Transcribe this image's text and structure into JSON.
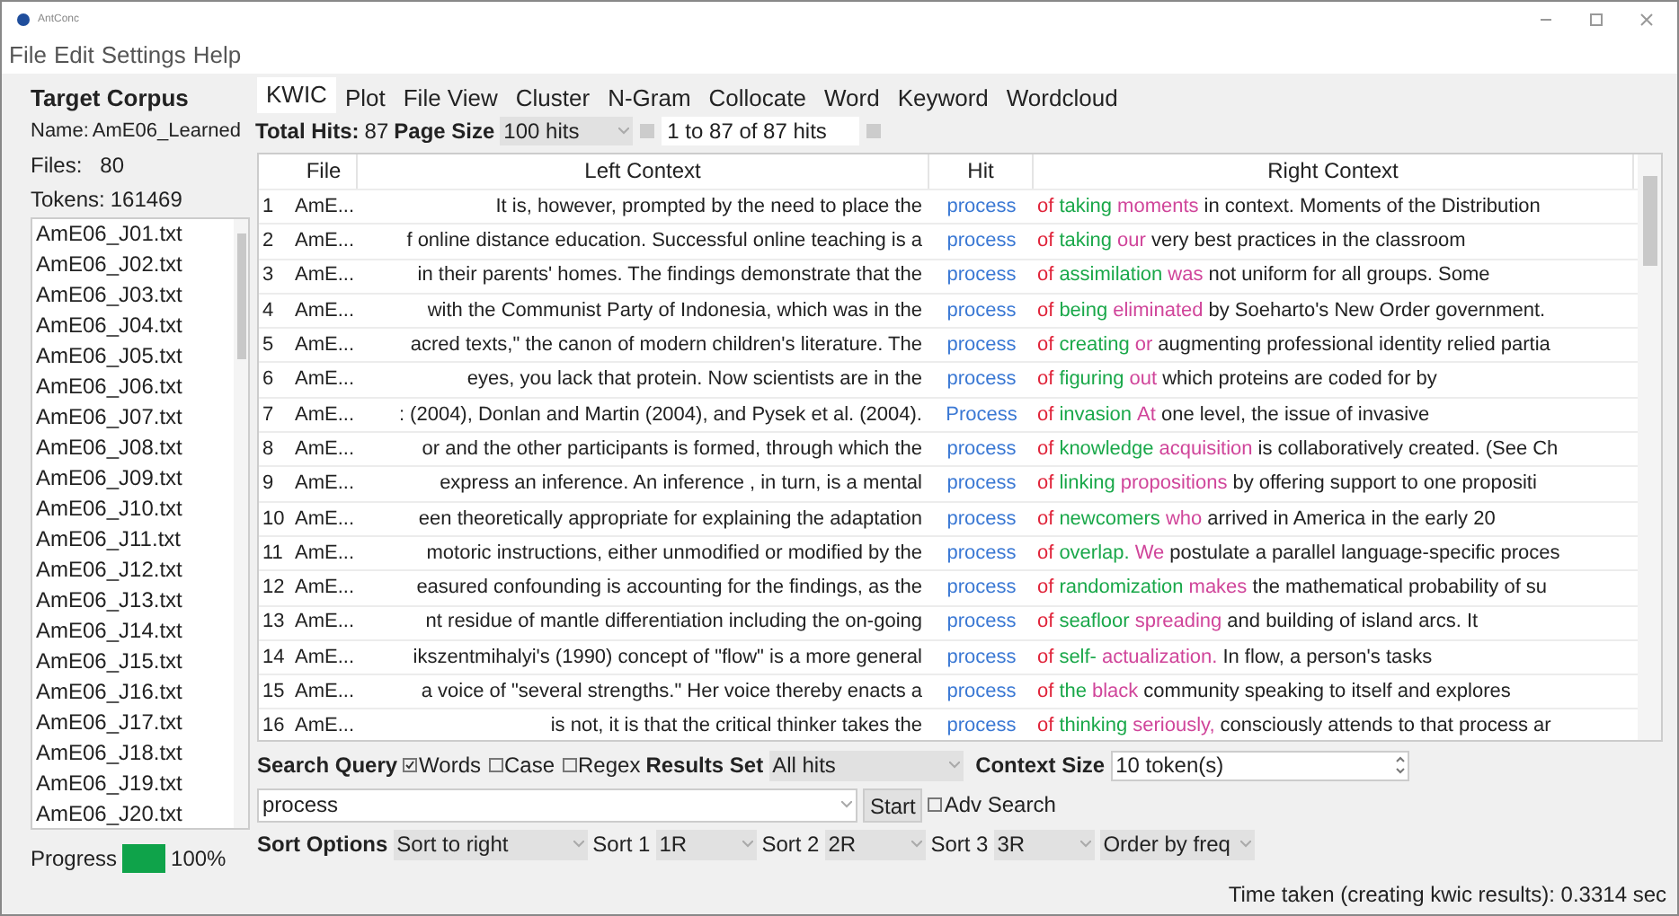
{
  "window": {
    "title": "AntConc"
  },
  "menu": [
    "File",
    "Edit",
    "Settings",
    "Help"
  ],
  "corpus": {
    "heading": "Target Corpus",
    "name_label": "Name:",
    "name": "AmE06_Learned",
    "files_label": "Files:",
    "files": "80",
    "tokens_label": "Tokens:",
    "tokens": "161469",
    "files_list": [
      "AmE06_J01.txt",
      "AmE06_J02.txt",
      "AmE06_J03.txt",
      "AmE06_J04.txt",
      "AmE06_J05.txt",
      "AmE06_J06.txt",
      "AmE06_J07.txt",
      "AmE06_J08.txt",
      "AmE06_J09.txt",
      "AmE06_J10.txt",
      "AmE06_J11.txt",
      "AmE06_J12.txt",
      "AmE06_J13.txt",
      "AmE06_J14.txt",
      "AmE06_J15.txt",
      "AmE06_J16.txt",
      "AmE06_J17.txt",
      "AmE06_J18.txt",
      "AmE06_J19.txt",
      "AmE06_J20.txt"
    ],
    "progress_label": "Progress",
    "progress": {
      "level": 1
    },
    "progress_text": "100%"
  },
  "tabs": [
    {
      "label": "KWIC",
      "selected": true
    },
    {
      "label": "Plot",
      "selected": false
    },
    {
      "label": "File View",
      "selected": false
    },
    {
      "label": "Cluster",
      "selected": false
    },
    {
      "label": "N-Gram",
      "selected": false
    },
    {
      "label": "Collocate",
      "selected": false
    },
    {
      "label": "Word",
      "selected": false
    },
    {
      "label": "Keyword",
      "selected": false
    },
    {
      "label": "Wordcloud",
      "selected": false
    }
  ],
  "hits_bar": {
    "total_label": "Total Hits:",
    "total": "87",
    "page_size_label": "Page Size",
    "page_size": "100 hits",
    "range": "1 to 87 of 87 hits"
  },
  "table": {
    "columns": [
      "File",
      "Left Context",
      "Hit",
      "Right Context"
    ],
    "rows": [
      {
        "n": "1",
        "file": "AmE...",
        "left": "It is, however, prompted by the need to place the",
        "hit": "process",
        "right": [
          "of",
          "taking",
          "moments"
        ],
        "rest": "in context. Moments of the Distribution"
      },
      {
        "n": "2",
        "file": "AmE...",
        "left": "f online distance education. Successful online teaching is a",
        "hit": "process",
        "right": [
          "of",
          "taking",
          "our"
        ],
        "rest": "very best practices in the classroom"
      },
      {
        "n": "3",
        "file": "AmE...",
        "left": "in their parents' homes. The findings demonstrate that the",
        "hit": "process",
        "right": [
          "of",
          "assimilation",
          "was"
        ],
        "rest": "not uniform for all groups. Some"
      },
      {
        "n": "4",
        "file": "AmE...",
        "left": "with the Communist Party of Indonesia, which was in the",
        "hit": "process",
        "right": [
          "of",
          "being",
          "eliminated"
        ],
        "rest": "by Soeharto's New Order government."
      },
      {
        "n": "5",
        "file": "AmE...",
        "left": "acred texts,\" the canon of modern children's literature. The",
        "hit": "process",
        "right": [
          "of",
          "creating",
          "or"
        ],
        "rest": "augmenting professional identity relied partia"
      },
      {
        "n": "6",
        "file": "AmE...",
        "left": "eyes, you lack that protein. Now scientists are in the",
        "hit": "process",
        "right": [
          "of",
          "figuring",
          "out"
        ],
        "rest": "which proteins are coded for by"
      },
      {
        "n": "7",
        "file": "AmE...",
        "left": ": (2004), Donlan and Martin (2004), and Pysek et al. (2004).",
        "hit": "Process",
        "right": [
          "of",
          "invasion",
          "At"
        ],
        "rest": "one level, the issue of invasive"
      },
      {
        "n": "8",
        "file": "AmE...",
        "left": "or and the other participants is formed, through which the",
        "hit": "process",
        "right": [
          "of",
          "knowledge",
          "acquisition"
        ],
        "rest": "is collaboratively created. (See Ch"
      },
      {
        "n": "9",
        "file": "AmE...",
        "left": "express an inference. An inference , in turn, is a mental",
        "hit": "process",
        "right": [
          "of",
          "linking",
          "propositions"
        ],
        "rest": "by offering support to one propositi"
      },
      {
        "n": "10",
        "file": "AmE...",
        "left": "een theoretically appropriate for explaining the adaptation",
        "hit": "process",
        "right": [
          "of",
          "newcomers",
          "who"
        ],
        "rest": "arrived in America in the early 20"
      },
      {
        "n": "11",
        "file": "AmE...",
        "left": "motoric instructions, either unmodified or modified by the",
        "hit": "process",
        "right": [
          "of",
          "overlap.",
          "We"
        ],
        "rest": "postulate a parallel language-specific proces"
      },
      {
        "n": "12",
        "file": "AmE...",
        "left": "easured confounding is accounting for the findings, as the",
        "hit": "process",
        "right": [
          "of",
          "randomization",
          "makes"
        ],
        "rest": "the mathematical probability of su"
      },
      {
        "n": "13",
        "file": "AmE...",
        "left": "nt residue of mantle differentiation including the on-going",
        "hit": "process",
        "right": [
          "of",
          "seafloor",
          "spreading"
        ],
        "rest": "and building of island arcs. It"
      },
      {
        "n": "14",
        "file": "AmE...",
        "left": "ikszentmihalyi's (1990) concept of \"flow\" is a more general",
        "hit": "process",
        "right": [
          "of",
          "self-",
          "actualization."
        ],
        "rest": "In flow, a person's tasks"
      },
      {
        "n": "15",
        "file": "AmE...",
        "left": "a voice of \"several strengths.\" Her voice thereby enacts a",
        "hit": "process",
        "right": [
          "of",
          "the",
          "black"
        ],
        "rest": "community speaking to itself and explores"
      },
      {
        "n": "16",
        "file": "AmE...",
        "left": "is not, it is that the critical thinker takes the",
        "hit": "process",
        "right": [
          "of",
          "thinking",
          "seriously,"
        ],
        "rest": "consciously attends to that process ar"
      }
    ]
  },
  "search": {
    "query_label": "Search Query",
    "options": [
      {
        "label": "Words",
        "checked": true
      },
      {
        "label": "Case",
        "checked": false
      },
      {
        "label": "Regex",
        "checked": false
      }
    ],
    "results_set_label": "Results Set",
    "results_set": "All hits",
    "context_size_label": "Context Size",
    "context_size": "10 token(s)",
    "query": "process",
    "start": "Start",
    "adv": {
      "label": "Adv Search",
      "checked": false
    }
  },
  "sort": {
    "label": "Sort Options",
    "mode": "Sort to right",
    "sorts": [
      {
        "label": "Sort 1",
        "value": "1R"
      },
      {
        "label": "Sort 2",
        "value": "2R"
      },
      {
        "label": "Sort 3",
        "value": "3R"
      }
    ],
    "order": "Order by freq"
  },
  "status_bar": "Time taken (creating kwic results):  0.3314 sec"
}
